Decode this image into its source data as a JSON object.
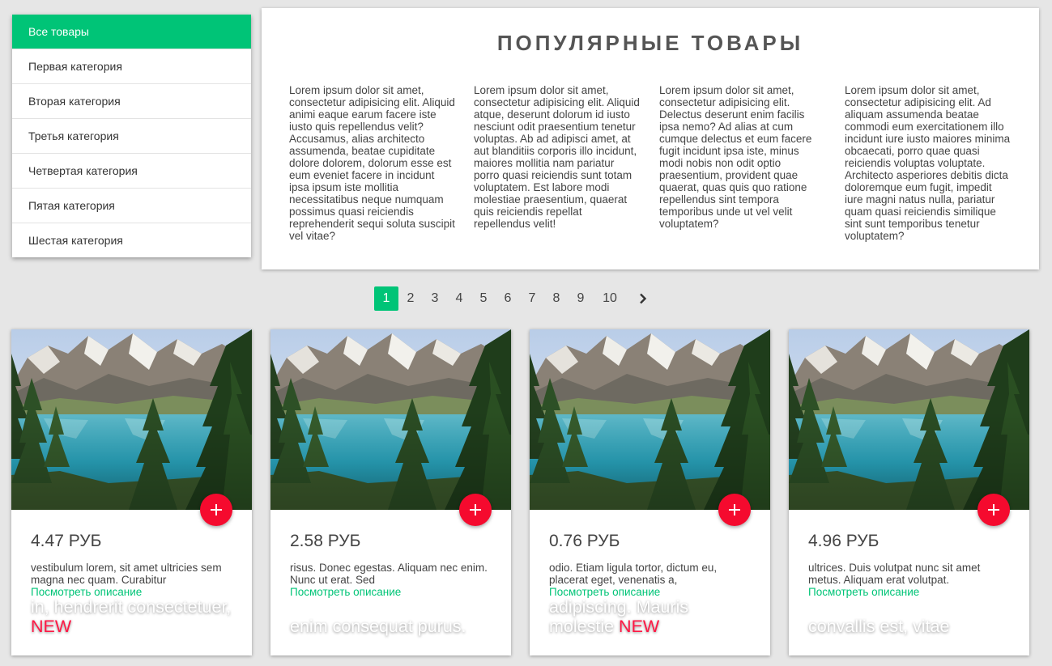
{
  "sidebar": {
    "items": [
      {
        "label": "Все товары",
        "active": true
      },
      {
        "label": "Первая категория"
      },
      {
        "label": "Вторая категория"
      },
      {
        "label": "Третья категория"
      },
      {
        "label": "Четвертая категория"
      },
      {
        "label": "Пятая категория"
      },
      {
        "label": "Шестая категория"
      }
    ]
  },
  "about": {
    "title": "ПОПУЛЯРНЫЕ ТОВАРЫ",
    "columns": [
      "Lorem ipsum dolor sit amet, consectetur adipisicing elit. Aliquid animi eaque earum facere iste iusto quis repellendus velit? Accusamus, alias architecto assumenda, beatae cupiditate dolore dolorem, dolorum esse est eum eveniet facere in incidunt ipsa ipsum iste mollitia necessitatibus neque numquam possimus quasi reiciendis reprehenderit sequi soluta suscipit vel vitae?",
      "Lorem ipsum dolor sit amet, consectetur adipisicing elit. Aliquid atque, deserunt dolorum id iusto nesciunt odit praesentium tenetur voluptas. Ab ad adipisci amet, at aut blanditiis corporis illo incidunt, maiores mollitia nam pariatur porro quasi reiciendis sunt totam voluptatem. Est labore modi molestiae praesentium, quaerat quis reiciendis repellat repellendus velit!",
      "Lorem ipsum dolor sit amet, consectetur adipisicing elit. Delectus deserunt enim facilis ipsa nemo? Ad alias at cum cumque delectus et eum facere fugit incidunt ipsa iste, minus modi nobis non odit optio praesentium, provident quae quaerat, quas quis quo ratione repellendus sint tempora temporibus unde ut vel velit voluptatem?",
      "Lorem ipsum dolor sit amet, consectetur adipisicing elit. Ad aliquam assumenda beatae commodi eum exercitationem illo incidunt iure iusto maiores minima obcaecati, porro quae quasi reiciendis voluptas voluptate. Architecto asperiores debitis dicta doloremque eum fugit, impedit iure magni natus nulla, pariatur quam quasi reiciendis similique sint sunt temporibus tenetur voluptatem?"
    ]
  },
  "pagination": {
    "pages": [
      "1",
      "2",
      "3",
      "4",
      "5",
      "6",
      "7",
      "8",
      "9",
      "10"
    ],
    "current": "1",
    "next_icon": "chevron-right-icon"
  },
  "products": [
    {
      "title": "in, hendrerit consectetuer,",
      "badge": "NEW",
      "price": "4.47 РУБ",
      "description": "vestibulum lorem, sit amet ultricies sem magna nec quam. Curabitur",
      "link": "Посмотреть описание"
    },
    {
      "title": "enim consequat purus.",
      "badge": "",
      "price": "2.58 РУБ",
      "description": "risus. Donec egestas. Aliquam nec enim. Nunc ut erat. Sed",
      "link": "Посмотреть описание"
    },
    {
      "title": "adipiscing. Mauris molestie",
      "badge": "NEW",
      "price": "0.76 РУБ",
      "description": "odio. Etiam ligula tortor, dictum eu, placerat eget, venenatis a,",
      "link": "Посмотреть описание"
    },
    {
      "title": "convallis est, vitae",
      "badge": "",
      "price": "4.96 РУБ",
      "description": "ultrices. Duis volutpat nunc sit amet metus. Aliquam erat volutpat.",
      "link": "Посмотреть описание"
    }
  ],
  "colors": {
    "accent": "#00c477",
    "add_button": "#f50a2e",
    "badge": "#ff1744",
    "background": "#e6e6e6"
  },
  "icons": {
    "add": "plus-icon",
    "image": "mountain-lake-photo"
  }
}
